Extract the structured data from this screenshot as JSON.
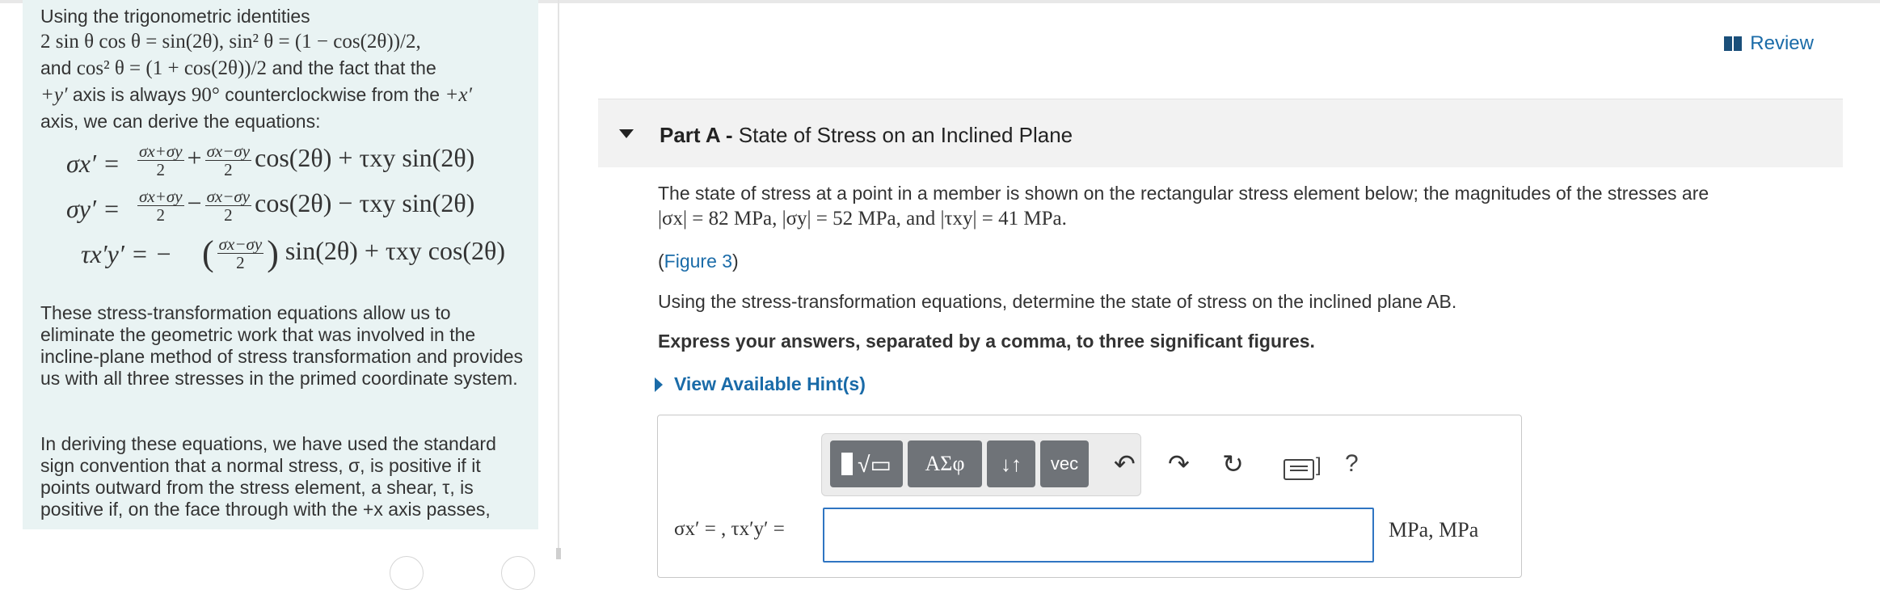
{
  "left_panel": {
    "intro_line1": "Using the trigonometric identities",
    "identity1": "2 sin θ cos θ = sin(2θ), sin² θ = (1 − cos(2θ))/2,",
    "identity2_pre": "and",
    "identity2": "cos² θ = (1 + cos(2θ))/2",
    "identity2_post": "and the fact that the",
    "axis_line_pre": "+y′",
    "axis_line_mid": "axis is always",
    "axis_line_deg": "90°",
    "axis_line_post": "counterclockwise from the",
    "axis_line_x": "+x′",
    "derive": "axis, we can derive the equations:",
    "eq1_lhs": "σx′ =",
    "eq1_rhs": "cos(2θ) + τxy sin(2θ)",
    "eq2_lhs": "σy′ =",
    "eq2_rhs": "cos(2θ) − τxy sin(2θ)",
    "eq3_lhs": "τx′y′ = −",
    "eq3_rhs": "sin(2θ) + τxy cos(2θ)",
    "frac_sum_num": "σx+σy",
    "frac_diff_num": "σx−σy",
    "frac_den": "2",
    "para2": "These stress-transformation equations allow us to eliminate the geometric work that was involved in the incline-plane method of stress transformation and provides us with all three stresses in the primed coordinate system.",
    "para3": "In deriving these equations, we have used the standard sign convention that a normal stress, σ, is positive if it points outward from the stress element, a shear, τ, is positive if, on the face through with the +x axis passes,"
  },
  "header": {
    "review_label": "Review",
    "review_icon": "book-icon"
  },
  "part_a": {
    "label": "Part A -",
    "title": "State of Stress on an Inclined Plane",
    "problem": "The state of stress at a point in a member is shown on the rectangular stress element below; the magnitudes of the stresses are",
    "magnitudes": "|σx| = 82 MPa, |σy| = 52 MPa, and |τxy| = 41 MPa.",
    "figure_open": "(",
    "figure_link": "Figure 3",
    "figure_close": ")",
    "instruction": "Using the stress-transformation equations, determine the state of stress on the inclined plane AB.",
    "format_note": "Express your answers, separated by a comma, to three significant figures.",
    "hint_link": "View Available Hint(s)"
  },
  "answer": {
    "toolbar": {
      "templates_icon": "templates-icon",
      "greek": "ΑΣφ",
      "arrows": "↓↑",
      "vec": "vec",
      "undo": "↶",
      "redo": "↷",
      "reset": "↻",
      "help": "?"
    },
    "label": "σx′ = , τx′y′ =",
    "value": "",
    "units": "MPa, MPa"
  }
}
